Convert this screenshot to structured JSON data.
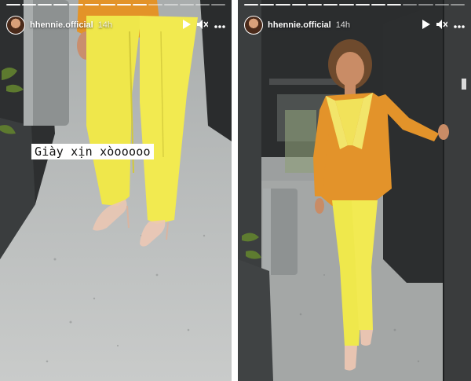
{
  "stories": [
    {
      "username": "hhennie.official",
      "time": "14h",
      "caption": "Giày xịn xòooooo",
      "icons": [
        "play-icon",
        "mute-icon",
        "more-icon"
      ]
    },
    {
      "username": "hhennie.official",
      "time": "14h",
      "icons": [
        "play-icon",
        "mute-icon",
        "more-icon"
      ]
    }
  ],
  "colors": {
    "pants": "#f0e84a",
    "blazer": "#e79a28",
    "floor": "#b9bcbc"
  }
}
